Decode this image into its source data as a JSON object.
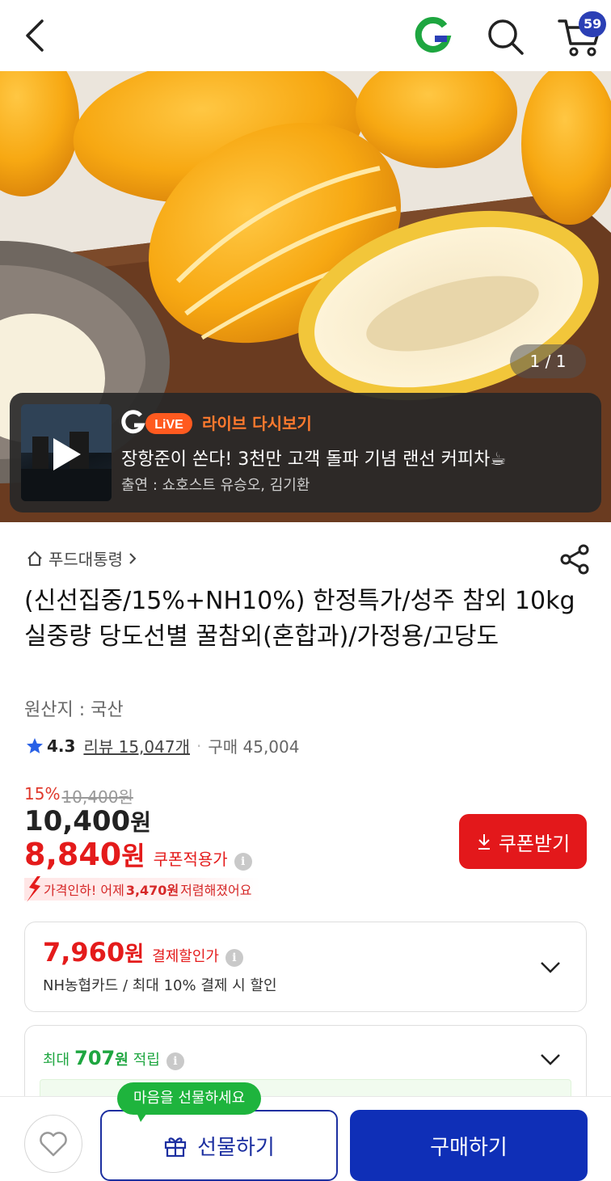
{
  "header": {
    "cart_count": "59",
    "icons": [
      "back-arrow-icon",
      "gmarket-g-logo",
      "search-icon",
      "cart-icon"
    ],
    "brand_green": "#1ea640",
    "brand_blue": "#2b3fb5"
  },
  "hero": {
    "image_counter": "1 / 1"
  },
  "live": {
    "logo_text": "LiVE",
    "title": "라이브 다시보기",
    "headline": "장항준이 쏜다! 3천만 고객 돌파 기념 랜선 커피차☕",
    "cast": "출연 : 쇼호스트 유승오, 김기환"
  },
  "product": {
    "breadcrumb": "푸드대통령",
    "title": "(신선집중/15%+NH10%) 한정특가/성주 참외 10kg 실중량 당도선별 꿀참외(혼합과)/가정용/고당도",
    "origin": "원산지 : 국산",
    "rating": "4.3",
    "reviews": "리뷰 15,047개",
    "purchases": "구매 45,004",
    "discount_rate": "15%",
    "original_price": "10,400",
    "original_price_unit": "원",
    "price": "10,400",
    "price_unit": "원",
    "coupon_price": "8,840",
    "coupon_price_unit": "원",
    "coupon_price_label": "쿠폰적용가",
    "coupon_button": "쿠폰받기",
    "price_drop_prefix": "가격인하! 어제",
    "price_drop_amount": "3,470원",
    "price_drop_suffix": "저렴해졌어요"
  },
  "payment_card": {
    "price": "7,960",
    "unit": "원",
    "label": "결제할인가",
    "sub": "NH농협카드 / 최대 10% 결제 시 할인"
  },
  "points_card": {
    "prefix": "최대",
    "amount": "707",
    "unit": "원",
    "label": "적립"
  },
  "bottom": {
    "tooltip": "마음을 선물하세요",
    "gift_button": "선물하기",
    "buy_button": "구매하기",
    "accent": "#0f2fb7"
  }
}
